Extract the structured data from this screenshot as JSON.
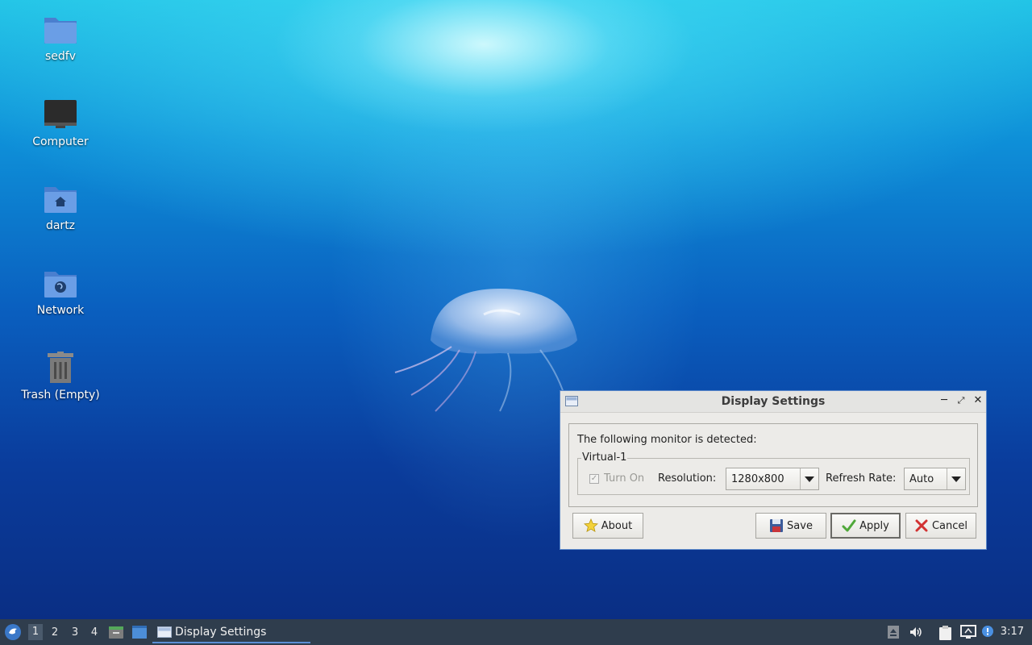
{
  "desktop": {
    "icons": [
      {
        "label": "sedfv"
      },
      {
        "label": "Computer"
      },
      {
        "label": "dartz"
      },
      {
        "label": "Network"
      },
      {
        "label": "Trash (Empty)"
      }
    ]
  },
  "dialog": {
    "title": "Display Settings",
    "detected_text": "The following monitor is detected:",
    "monitor_name": "Virtual-1",
    "turn_on_label": "Turn On",
    "turn_on_checked": true,
    "resolution_label": "Resolution:",
    "resolution_value": "1280x800",
    "refresh_label": "Refresh Rate:",
    "refresh_value": "Auto",
    "buttons": {
      "about": "About",
      "save": "Save",
      "apply": "Apply",
      "cancel": "Cancel"
    }
  },
  "taskbar": {
    "workspaces": [
      "1",
      "2",
      "3",
      "4"
    ],
    "active_workspace": "1",
    "task_label": "Display Settings",
    "clock": "3:17"
  },
  "colors": {
    "taskbar_bg": "#2f3d4d",
    "dialog_bg": "#ecebe8",
    "dialog_border": "#5a87c8",
    "folder_blue": "#5b8fd9"
  }
}
